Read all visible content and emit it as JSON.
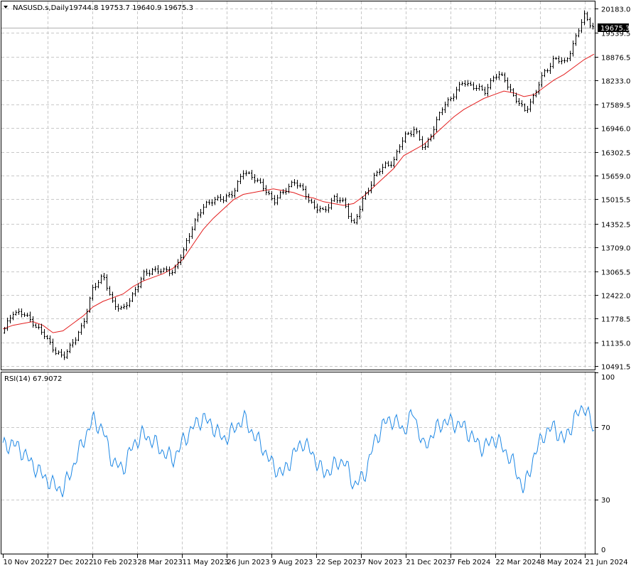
{
  "window": {
    "symbol_label": "NASUSD.s,Daily",
    "ohlc_label": "19744.8 19753.7 19640.9 19675.3",
    "current_price_label": "19675.3",
    "menu_icon": "triangle-down-icon"
  },
  "colors": {
    "bars": "#000000",
    "ma": "#e31e1e",
    "rsi": "#1e88e5",
    "grid": "#c8c8c8",
    "price_line": "#b0b0b0",
    "current_price_bg": "#000000"
  },
  "price_panel": {
    "ylim": [
      10400,
      20380
    ],
    "current_price": 19675.3,
    "ticks": [
      20183.0,
      19539.5,
      18876.5,
      18233.0,
      17589.5,
      16946.0,
      16302.5,
      15659.0,
      15015.5,
      14352.5,
      13709.0,
      13065.5,
      12422.0,
      11778.5,
      11135.0,
      10491.5
    ],
    "tick_labels": [
      "20183.0",
      "19539.5",
      "18876.5",
      "18233.0",
      "17589.5",
      "16946.0",
      "16302.5",
      "15659.0",
      "15015.5",
      "14352.5",
      "13709.0",
      "13065.5",
      "12422.0",
      "11778.5",
      "11135.0",
      "10491.5"
    ]
  },
  "rsi_panel": {
    "label": "RSI(14) 67.9072",
    "ylim": [
      0,
      100
    ],
    "ticks": [
      100,
      70,
      30,
      0
    ],
    "tick_labels": [
      "100",
      "70",
      "30",
      "0"
    ]
  },
  "time_axis": {
    "labels": [
      "10 Nov 2022",
      "27 Dec 2022",
      "10 Feb 2023",
      "28 Mar 2023",
      "11 May 2023",
      "26 Jun 2023",
      "9 Aug 2023",
      "22 Sep 2023",
      "7 Nov 2023",
      "21 Dec 2023",
      "7 Feb 2024",
      "22 Mar 2024",
      "8 May 2024",
      "21 Jun 2024"
    ]
  },
  "chart_data": [
    {
      "type": "line",
      "title": "NASUSD.s,Daily",
      "series": [
        {
          "name": "NASUSD.s",
          "values": [
            11400,
            12000,
            11900,
            11700,
            11350,
            11000,
            10700,
            11200,
            11600,
            12700,
            12900,
            12200,
            12000,
            12500,
            12950,
            13150,
            13050,
            13100,
            13600,
            14400,
            14800,
            15050,
            15000,
            15250,
            15750,
            15650,
            15300,
            15000,
            15200,
            15550,
            15200,
            14850,
            14650,
            15100,
            14900,
            14350,
            15050,
            15650,
            15900,
            16100,
            16700,
            16950,
            16350,
            17000,
            17550,
            17900,
            18200,
            18100,
            17900,
            18400,
            18300,
            17800,
            17400,
            17850,
            18450,
            18850,
            18700,
            19300,
            20000,
            19675
          ]
        },
        {
          "name": "MA",
          "values": [
            11500,
            11600,
            11650,
            11700,
            11600,
            11400,
            11450,
            11650,
            11850,
            12100,
            12250,
            12350,
            12450,
            12650,
            12800,
            12900,
            13000,
            13150,
            13400,
            13800,
            14200,
            14500,
            14750,
            15000,
            15150,
            15200,
            15250,
            15300,
            15250,
            15200,
            15100,
            15050,
            14950,
            14900,
            14850,
            14900,
            15100,
            15350,
            15600,
            15850,
            16200,
            16350,
            16500,
            16750,
            17000,
            17250,
            17450,
            17600,
            17750,
            17850,
            17950,
            17900,
            17800,
            17850,
            18050,
            18250,
            18400,
            18600,
            18800,
            18950
          ]
        }
      ],
      "ylim": [
        10400,
        20380
      ]
    },
    {
      "type": "line",
      "title": "RSI(14) 67.9072",
      "series": [
        {
          "name": "RSI(14)",
          "values": [
            59,
            61,
            56,
            49,
            43,
            38,
            35,
            48,
            62,
            74,
            68,
            50,
            47,
            60,
            66,
            62,
            56,
            52,
            62,
            70,
            75,
            70,
            63,
            68,
            75,
            66,
            58,
            48,
            44,
            55,
            62,
            54,
            44,
            48,
            52,
            38,
            42,
            60,
            72,
            74,
            68,
            78,
            58,
            67,
            73,
            72,
            70,
            63,
            58,
            64,
            58,
            49,
            35,
            54,
            66,
            70,
            62,
            74,
            82,
            67.9
          ]
        }
      ],
      "ylim": [
        0,
        100
      ],
      "ticks": [
        30,
        70
      ]
    }
  ]
}
